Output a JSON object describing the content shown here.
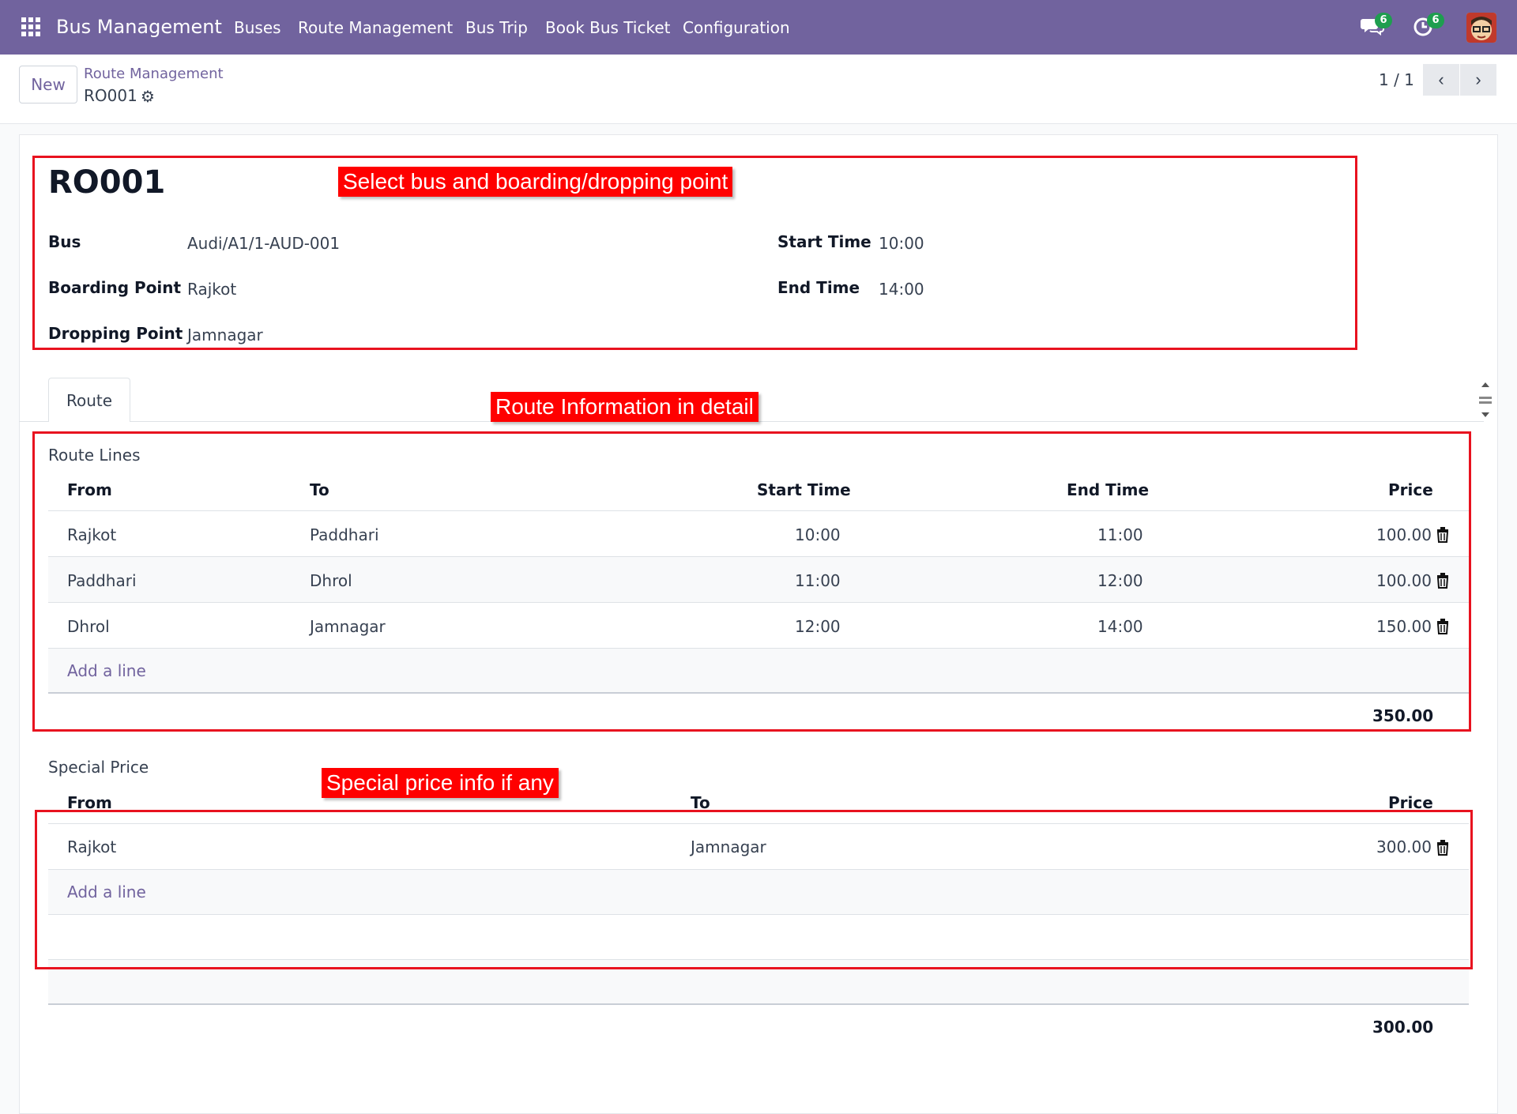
{
  "navbar": {
    "brand": "Bus Management",
    "menus": [
      "Buses",
      "Route Management",
      "Bus Trip",
      "Book Bus Ticket",
      "Configuration"
    ],
    "messages_badge": "6",
    "activities_badge": "6",
    "icons": [
      "apps-grid-icon",
      "chat-icon",
      "clock-icon",
      "avatar"
    ]
  },
  "control": {
    "new_label": "New",
    "breadcrumb_parent": "Route Management",
    "breadcrumb_current": "RO001",
    "pager": "1 / 1"
  },
  "record": {
    "name": "RO001",
    "fields": {
      "bus_label": "Bus",
      "bus_value": "Audi/A1/1-AUD-001",
      "boarding_label": "Boarding Point",
      "boarding_value": "Rajkot",
      "dropping_label": "Dropping Point",
      "dropping_value": "Jamnagar",
      "start_label": "Start Time",
      "start_value": "10:00",
      "end_label": "End Time",
      "end_value": "14:00"
    }
  },
  "tabs": [
    "Route"
  ],
  "route_lines": {
    "title": "Route Lines",
    "headers": [
      "From",
      "To",
      "Start Time",
      "End Time",
      "Price"
    ],
    "rows": [
      [
        "Rajkot",
        "Paddhari",
        "10:00",
        "11:00",
        "100.00"
      ],
      [
        "Paddhari",
        "Dhrol",
        "11:00",
        "12:00",
        "100.00"
      ],
      [
        "Dhrol",
        "Jamnagar",
        "12:00",
        "14:00",
        "150.00"
      ]
    ],
    "add_line": "Add a line",
    "total": "350.00"
  },
  "special_price": {
    "title": "Special Price",
    "headers": [
      "From",
      "To",
      "Price"
    ],
    "rows": [
      [
        "Rajkot",
        "Jamnagar",
        "300.00"
      ]
    ],
    "add_line": "Add a line",
    "total": "300.00"
  },
  "annotations": {
    "a1": "Select bus and boarding/dropping point",
    "a2": "Route Information in detail",
    "a3": "Special price info if any"
  },
  "colors": {
    "navbar": "#71639e",
    "annotation": "#ff0000",
    "badge": "#1e9e4f"
  }
}
